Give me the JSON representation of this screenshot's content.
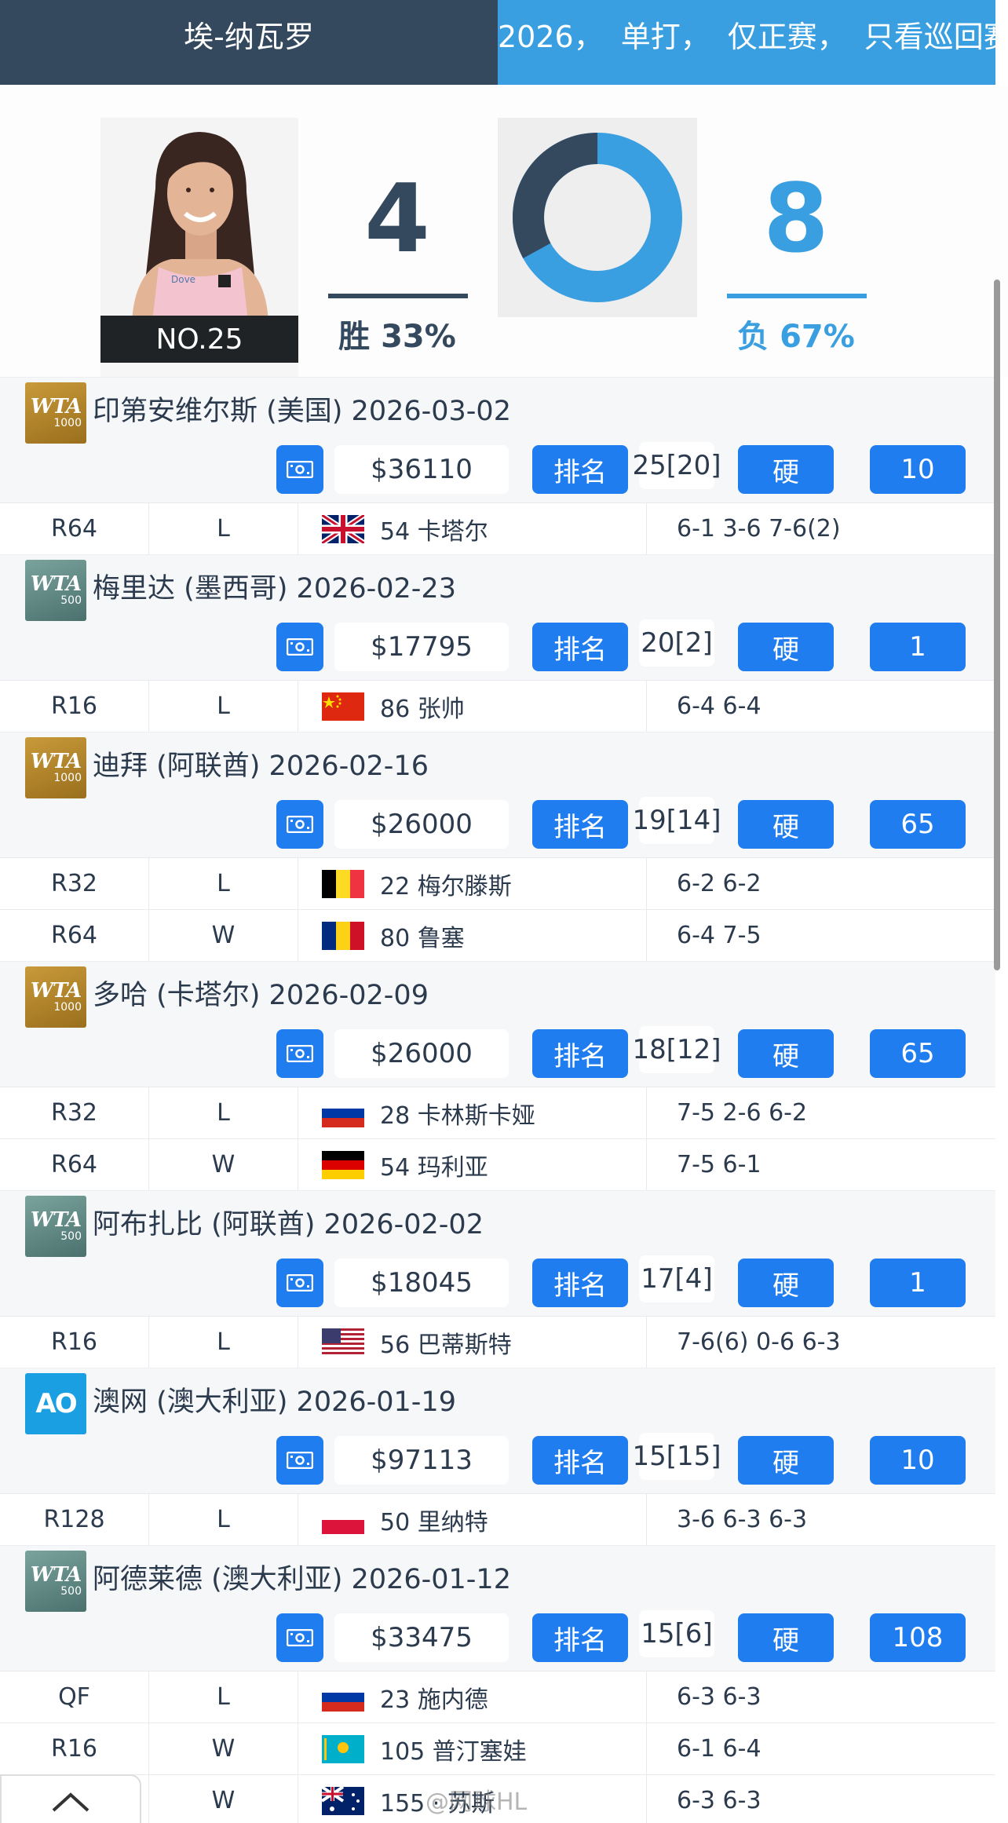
{
  "header": {
    "player": "埃-纳瓦罗",
    "filters": [
      "2026，",
      "单打，",
      "仅正赛，",
      "只看巡回赛"
    ]
  },
  "summary": {
    "rank_badge": "NO.25",
    "wins": "4",
    "losses": "8",
    "win_label": "胜 33%",
    "loss_label": "负 67%",
    "win_fraction": 0.33,
    "colors": {
      "win": "#34495e",
      "loss": "#3a9fe0"
    }
  },
  "tournaments": [
    {
      "logo": "wta-1000",
      "logo_text": "WTA",
      "logo_sub": "1000",
      "title": "印第安维尔斯 (美国) 2026-03-02",
      "prize": "$36110",
      "rank_btn": "排名",
      "rank": "25[20]",
      "surface": "硬",
      "points": "10",
      "matches": [
        {
          "round": "R64",
          "result": "L",
          "flag": "gb",
          "opponent": "54 卡塔尔",
          "score": "6-1 3-6 7-6(2)"
        }
      ]
    },
    {
      "logo": "wta-500",
      "logo_text": "WTA",
      "logo_sub": "500",
      "title": "梅里达 (墨西哥) 2026-02-23",
      "prize": "$17795",
      "rank_btn": "排名",
      "rank": "20[2]",
      "surface": "硬",
      "points": "1",
      "matches": [
        {
          "round": "R16",
          "result": "L",
          "flag": "cn",
          "opponent": "86 张帅",
          "score": "6-4 6-4"
        }
      ]
    },
    {
      "logo": "wta-1000",
      "logo_text": "WTA",
      "logo_sub": "1000",
      "title": "迪拜 (阿联酋) 2026-02-16",
      "prize": "$26000",
      "rank_btn": "排名",
      "rank": "19[14]",
      "surface": "硬",
      "points": "65",
      "matches": [
        {
          "round": "R32",
          "result": "L",
          "flag": "be",
          "opponent": "22 梅尔滕斯",
          "score": "6-2 6-2"
        },
        {
          "round": "R64",
          "result": "W",
          "flag": "ro",
          "opponent": "80 鲁塞",
          "score": "6-4 7-5"
        }
      ]
    },
    {
      "logo": "wta-1000",
      "logo_text": "WTA",
      "logo_sub": "1000",
      "title": "多哈 (卡塔尔) 2026-02-09",
      "prize": "$26000",
      "rank_btn": "排名",
      "rank": "18[12]",
      "surface": "硬",
      "points": "65",
      "matches": [
        {
          "round": "R32",
          "result": "L",
          "flag": "ru",
          "opponent": "28 卡林斯卡娅",
          "score": "7-5 2-6 6-2"
        },
        {
          "round": "R64",
          "result": "W",
          "flag": "de",
          "opponent": "54 玛利亚",
          "score": "7-5 6-1"
        }
      ]
    },
    {
      "logo": "wta-500",
      "logo_text": "WTA",
      "logo_sub": "500",
      "title": "阿布扎比 (阿联酋) 2026-02-02",
      "prize": "$18045",
      "rank_btn": "排名",
      "rank": "17[4]",
      "surface": "硬",
      "points": "1",
      "matches": [
        {
          "round": "R16",
          "result": "L",
          "flag": "us",
          "opponent": "56 巴蒂斯特",
          "score": "7-6(6) 0-6 6-3"
        }
      ]
    },
    {
      "logo": "ao",
      "logo_text": "AO",
      "logo_sub": "",
      "title": "澳网 (澳大利亚) 2026-01-19",
      "prize": "$97113",
      "rank_btn": "排名",
      "rank": "15[15]",
      "surface": "硬",
      "points": "10",
      "matches": [
        {
          "round": "R128",
          "result": "L",
          "flag": "pl",
          "opponent": "50 里纳特",
          "score": "3-6 6-3 6-3"
        }
      ]
    },
    {
      "logo": "wta-500",
      "logo_text": "WTA",
      "logo_sub": "500",
      "title": "阿德莱德 (澳大利亚) 2026-01-12",
      "prize": "$33475",
      "rank_btn": "排名",
      "rank": "15[6]",
      "surface": "硬",
      "points": "108",
      "matches": [
        {
          "round": "QF",
          "result": "L",
          "flag": "ru",
          "opponent": "23 施内德",
          "score": "6-3 6-3"
        },
        {
          "round": "R16",
          "result": "W",
          "flag": "kz",
          "opponent": "105 普汀塞娃",
          "score": "6-1 6-4"
        },
        {
          "round": "",
          "result": "W",
          "flag": "au",
          "opponent": "155 · 苏斯",
          "score": "6-3 6-3"
        }
      ]
    }
  ],
  "watermark": "@网球HL",
  "icons": {
    "prize": "money-icon",
    "back_to_top": "chevron-up-icon"
  }
}
